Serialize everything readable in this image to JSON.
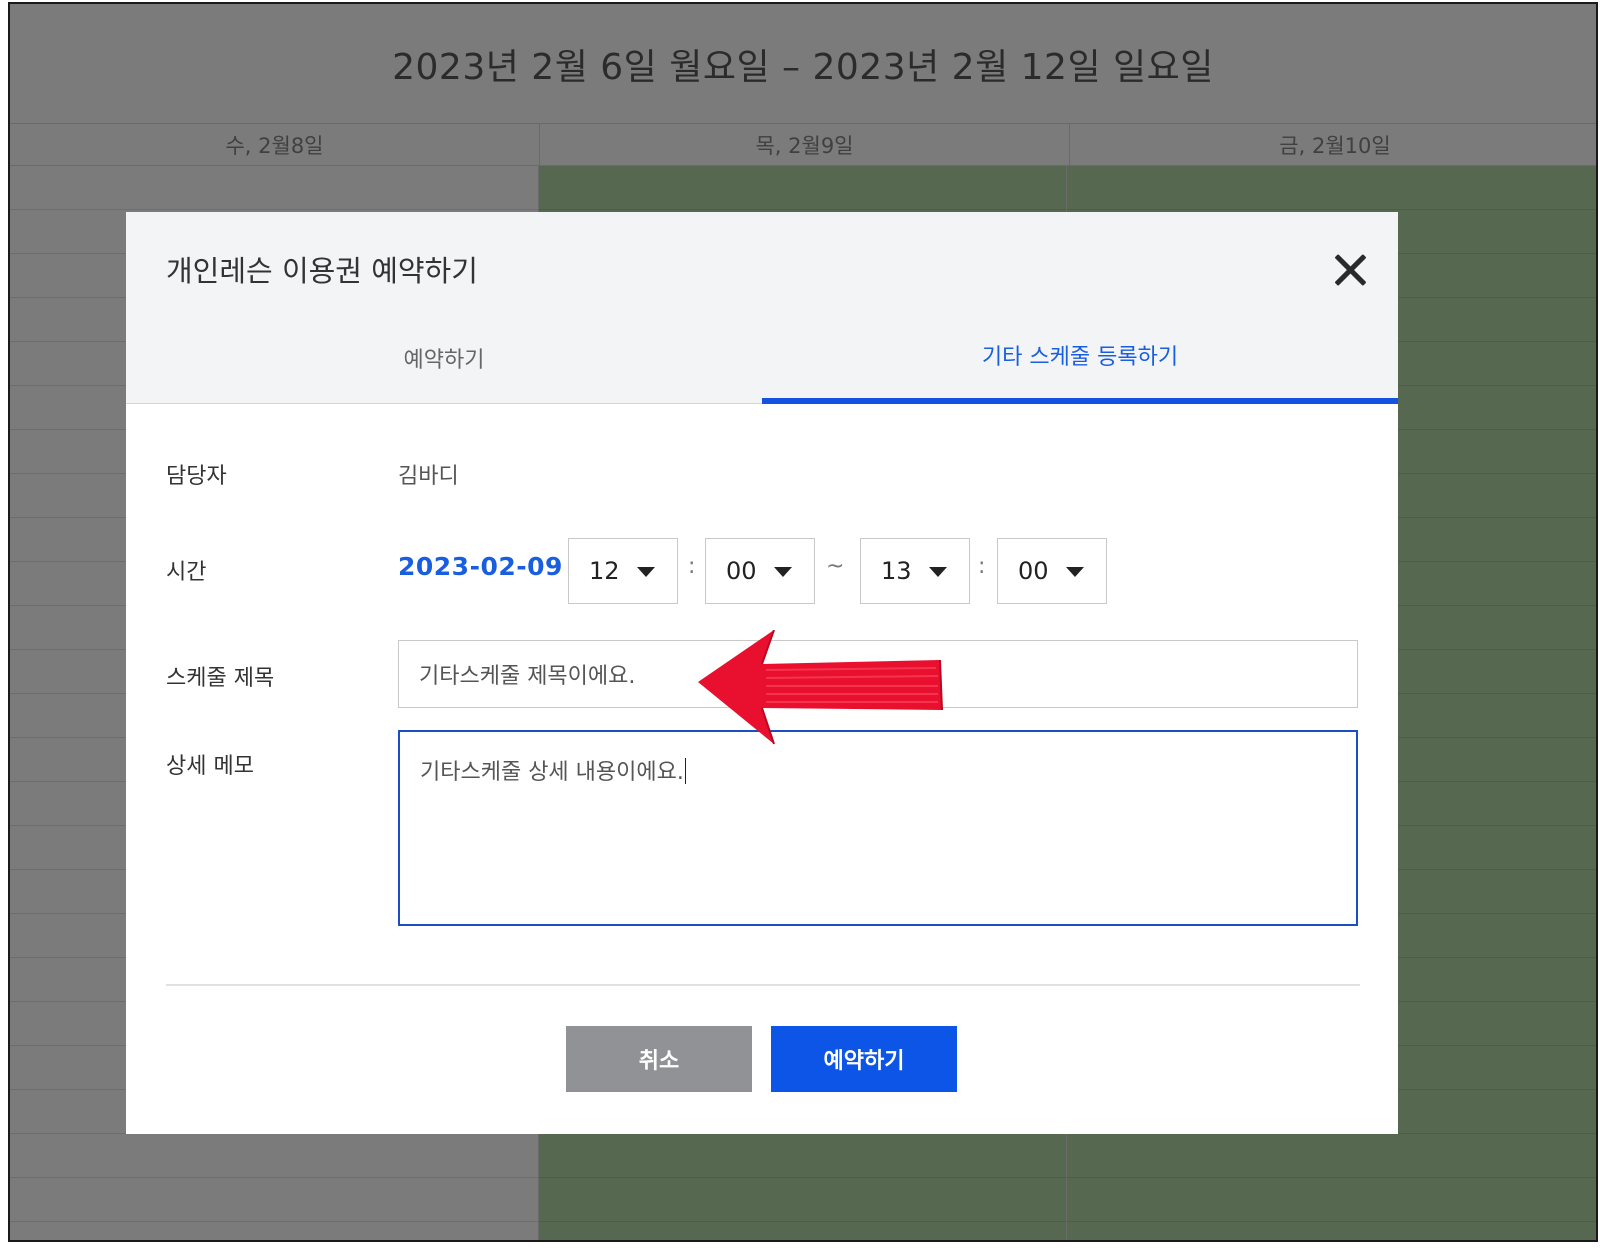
{
  "calendar": {
    "title": "2023년 2월 6일 월요일 – 2023년 2월 12일 일요일",
    "days": [
      "수, 2월8일",
      "목, 2월9일",
      "금, 2월10일"
    ]
  },
  "modal": {
    "title": "개인레슨 이용권 예약하기",
    "tabs": [
      "예약하기",
      "기타 스케줄 등록하기"
    ],
    "active_tab": "기타 스케줄 등록하기",
    "labels": {
      "staff": "담당자",
      "time": "시간",
      "schedule_title": "스케줄 제목",
      "memo": "상세 메모"
    },
    "staff_value": "김바디",
    "date": "2023-02-09",
    "time": {
      "start_hour": "12",
      "start_min": "00",
      "end_hour": "13",
      "end_min": "00",
      "colon": ":",
      "tilde": "~"
    },
    "schedule_title_value": "기타스케줄 제목이에요.",
    "memo_value": "기타스케줄 상세 내용이에요.",
    "buttons": {
      "cancel": "취소",
      "submit": "예약하기"
    }
  },
  "colors": {
    "accent": "#1552e0",
    "cancel_button": "#909296",
    "annotation_arrow": "#e8102e"
  }
}
